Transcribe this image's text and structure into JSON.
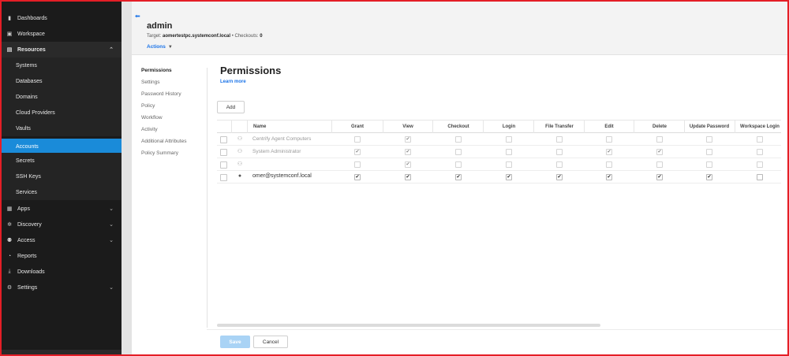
{
  "sidebar": {
    "top": [
      {
        "label": "Dashboards",
        "icon": "bar-chart-icon"
      },
      {
        "label": "Workspace",
        "icon": "workspace-icon"
      }
    ],
    "resources": {
      "label": "Resources",
      "icon": "resources-icon"
    },
    "sub_items": [
      {
        "label": "Systems"
      },
      {
        "label": "Databases"
      },
      {
        "label": "Domains"
      },
      {
        "label": "Cloud Providers"
      },
      {
        "label": "Vaults"
      },
      {
        "label": "Accounts"
      },
      {
        "label": "Secrets"
      },
      {
        "label": "SSH Keys"
      },
      {
        "label": "Services"
      }
    ],
    "bottom": [
      {
        "label": "Apps",
        "icon": "apps-icon"
      },
      {
        "label": "Discovery",
        "icon": "discovery-icon"
      },
      {
        "label": "Access",
        "icon": "access-icon"
      },
      {
        "label": "Reports",
        "icon": "reports-icon"
      },
      {
        "label": "Downloads",
        "icon": "downloads-icon"
      },
      {
        "label": "Settings",
        "icon": "gear-icon"
      }
    ],
    "active_item": "Accounts"
  },
  "header": {
    "title": "admin",
    "target_label": "Target:",
    "target_value": "aomertestpc.systemconf.local",
    "separator": "•",
    "checkouts_label": "Checkouts:",
    "checkouts_value": "0",
    "actions_label": "Actions"
  },
  "section_nav": [
    {
      "label": "Permissions"
    },
    {
      "label": "Settings"
    },
    {
      "label": "Password History"
    },
    {
      "label": "Policy"
    },
    {
      "label": "Workflow"
    },
    {
      "label": "Activity"
    },
    {
      "label": "Additional Attributes"
    },
    {
      "label": "Policy Summary"
    }
  ],
  "content": {
    "heading": "Permissions",
    "learn_more": "Learn more",
    "add_label": "Add"
  },
  "table": {
    "name_header": "Name",
    "columns": [
      "Grant",
      "View",
      "Checkout",
      "Login",
      "File Transfer",
      "Edit",
      "Delete",
      "Update Password",
      "Workspace Login"
    ],
    "rows": [
      {
        "type_icon": "group-icon",
        "name": "Centrify Agent Computers",
        "enabled": false,
        "checks": [
          false,
          true,
          false,
          false,
          false,
          false,
          false,
          false,
          false
        ]
      },
      {
        "type_icon": "group-icon",
        "name": "System Administrator",
        "enabled": false,
        "checks": [
          true,
          true,
          false,
          false,
          false,
          true,
          true,
          false,
          false
        ]
      },
      {
        "type_icon": "group-icon",
        "name": "",
        "enabled": false,
        "checks": [
          false,
          true,
          false,
          false,
          false,
          false,
          false,
          false,
          false
        ]
      },
      {
        "type_icon": "user-icon",
        "name": "omer@systemconf.local",
        "enabled": true,
        "checks": [
          true,
          true,
          true,
          true,
          true,
          true,
          true,
          true,
          false
        ]
      }
    ]
  },
  "footer": {
    "save_label": "Save",
    "cancel_label": "Cancel"
  }
}
